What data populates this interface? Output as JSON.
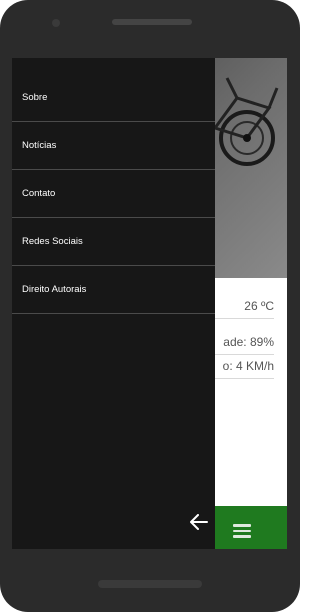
{
  "drawer": {
    "items": [
      {
        "label": "Sobre"
      },
      {
        "label": "Notícias"
      },
      {
        "label": "Contato"
      },
      {
        "label": "Redes Sociais"
      },
      {
        "label": "Direito Autorais"
      }
    ],
    "back_icon": "arrow-left-icon"
  },
  "weather": {
    "temperature": "26 ºC",
    "humidity": "ade: 89%",
    "wind": "o: 4 KM/h"
  },
  "bottom_bar": {
    "menu_icon": "hamburger-menu-icon",
    "color": "#1f7a1f"
  }
}
